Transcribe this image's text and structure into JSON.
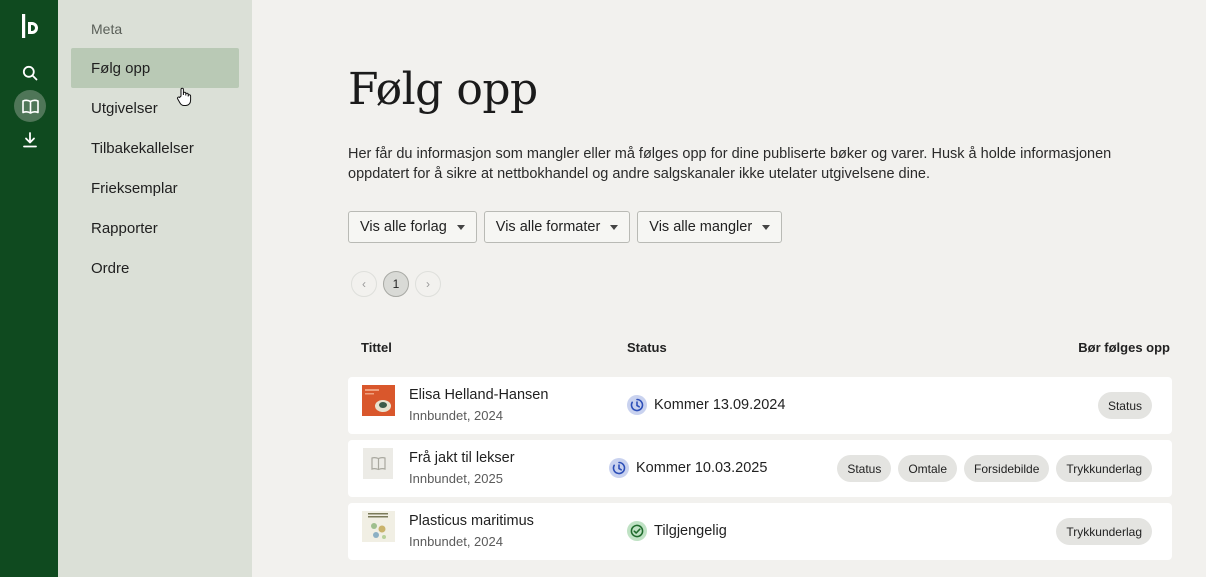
{
  "sidebar": {
    "section_label": "Meta",
    "items": [
      {
        "label": "Følg opp"
      },
      {
        "label": "Utgivelser"
      },
      {
        "label": "Tilbakekallelser"
      },
      {
        "label": "Frieksemplar"
      },
      {
        "label": "Rapporter"
      },
      {
        "label": "Ordre"
      }
    ],
    "active_item": "Følg opp"
  },
  "rail": {
    "icons": [
      "logo-icon",
      "search-icon",
      "book-icon",
      "download-icon"
    ],
    "active_icon": "book-icon"
  },
  "main": {
    "title": "Følg opp",
    "description": "Her får du informasjon som mangler eller må følges opp for dine publiserte bøker og varer. Husk å holde informasjonen oppdatert for å sikre at nettbokhandel og andre salgskanaler ikke utelater utgivelsene dine.",
    "filters": [
      {
        "label": "Vis alle forlag"
      },
      {
        "label": "Vis alle formater"
      },
      {
        "label": "Vis alle mangler"
      }
    ],
    "pagination": {
      "prev": "‹",
      "current": "1",
      "next": "›"
    },
    "table": {
      "headers": {
        "title": "Tittel",
        "status": "Status",
        "follow_up": "Bør følges opp"
      },
      "rows": [
        {
          "title": "Elisa Helland-Hansen",
          "subtitle": "Innbundet, 2024",
          "status": "Kommer 13.09.2024",
          "status_icon": "clock-icon",
          "chips": [
            "Status"
          ]
        },
        {
          "title": "Frå jakt til lekser",
          "subtitle": "Innbundet, 2025",
          "status": "Kommer 10.03.2025",
          "status_icon": "clock-icon",
          "chips": [
            "Status",
            "Omtale",
            "Forsidebilde",
            "Trykkunderlag"
          ]
        },
        {
          "title": "Plasticus maritimus",
          "subtitle": "Innbundet, 2024",
          "status": "Tilgjengelig",
          "status_icon": "check-circle-icon",
          "chips": [
            "Trykkunderlag"
          ]
        }
      ]
    }
  },
  "colors": {
    "rail_bg": "#0f4a1f",
    "sidebar_bg": "#dbe0d7",
    "sidebar_active": "#b9c9b5",
    "page_bg": "#f2f1ee",
    "clock_badge": "#c9d2ef",
    "check_badge": "#bfe2c4"
  }
}
